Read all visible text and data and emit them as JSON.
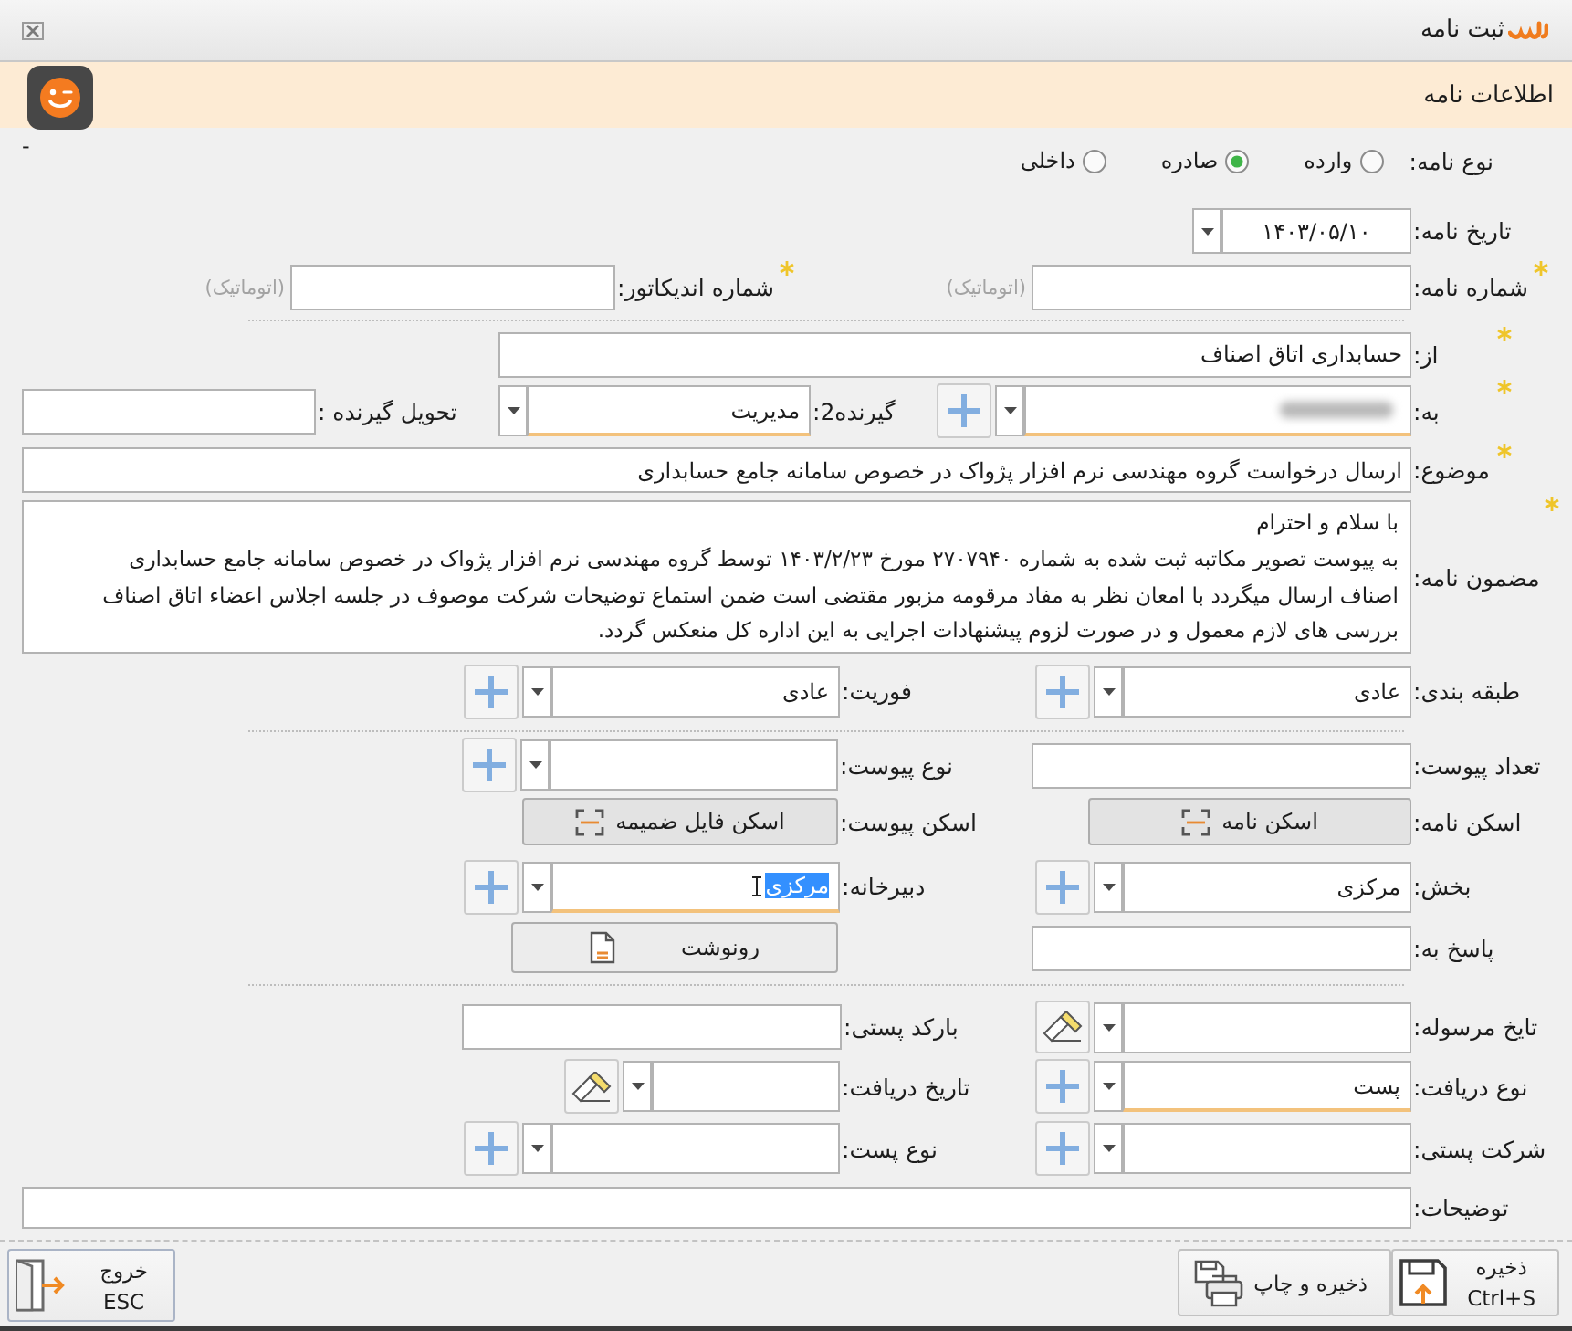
{
  "window": {
    "title": "ثبت نامه"
  },
  "header": {
    "title": "اطلاعات نامه",
    "mark": "-"
  },
  "letter_type": {
    "label": "نوع نامه:",
    "options": [
      {
        "label": "وارده",
        "selected": false
      },
      {
        "label": "صادره",
        "selected": true
      },
      {
        "label": "داخلی",
        "selected": false
      }
    ]
  },
  "sections": [
    {
      "rows": [
        {
          "fields": [
            {
              "kind": "date",
              "label": "تاریخ نامه:",
              "required": false,
              "value": "۱۴۰۳/۰۵/۱۰"
            }
          ]
        },
        {
          "fields": [
            {
              "kind": "text",
              "label": "شماره نامه:",
              "required": true,
              "note": "(اتوماتیک)"
            },
            {
              "kind": "text",
              "label": "شماره اندیکاتور:",
              "required": true,
              "note": "(اتوماتیک)"
            }
          ]
        }
      ]
    },
    {
      "rows": [
        {
          "fields": [
            {
              "kind": "text",
              "label": "از:",
              "required": true,
              "value": "حسابداری اتاق اصناف"
            }
          ]
        },
        {
          "fields": [
            {
              "kind": "combo",
              "label": "به:",
              "required": true,
              "redacted": true,
              "highlighted": true,
              "add_button": true,
              "clear_button": false
            },
            {
              "kind": "combo",
              "label": "گیرنده2:",
              "required": false,
              "value": "مدیریت",
              "highlighted": true,
              "add_button": false,
              "clear_button": false
            },
            {
              "kind": "text",
              "label": "تحویل گیرنده :",
              "required": false
            }
          ]
        },
        {
          "fields": [
            {
              "kind": "text",
              "label": "موضوع:",
              "required": true,
              "value": "ارسال درخواست گروه مهندسی نرم افزار پژواک در خصوص سامانه جامع حسابداری"
            }
          ]
        },
        {
          "fields": [
            {
              "kind": "textarea",
              "label": "مضمون نامه:",
              "required": true,
              "lines": [
                "با سلام و احترام",
                "به پیوست تصویر مکاتبه ثبت شده به شماره ۲۷۰۷۹۴۰ مورخ ۱۴۰۳/۲/۲۳ توسط گروه مهندسی نرم افزار پژواک در خصوص سامانه جامع حسابداری",
                "اصناف ارسال میگردد با امعان نظر به مفاد مرقومه مزبور مقتضی است ضمن استماع توضیحات شرکت موصوف در جلسه اجلاس اعضاء اتاق اصناف",
                "بررسی های لازم معمول و در صورت لزوم پیشنهادات اجرایی به این اداره کل منعکس گردد."
              ]
            }
          ]
        },
        {
          "fields": [
            {
              "kind": "combo",
              "label": "طبقه بندی:",
              "required": false,
              "value": "عادی",
              "highlighted": false,
              "add_button": true,
              "clear_button": false
            },
            {
              "kind": "combo",
              "label": "فوریت:",
              "required": false,
              "value": "عادی",
              "highlighted": false,
              "add_button": true,
              "clear_button": false
            }
          ]
        }
      ]
    },
    {
      "rows": [
        {
          "fields": [
            {
              "kind": "text",
              "label": "تعداد پیوست:",
              "required": false
            },
            {
              "kind": "combo",
              "label": "نوع پیوست:",
              "required": false,
              "highlighted": false,
              "add_button": true,
              "clear_button": false
            }
          ]
        },
        {
          "fields": [
            {
              "kind": "scan",
              "label": "اسکن نامه:",
              "required": false,
              "button": "اسکن نامه"
            },
            {
              "kind": "scan",
              "label": "اسکن پیوست:",
              "required": false,
              "button": "اسکن فایل ضمیمه"
            }
          ]
        },
        {
          "fields": [
            {
              "kind": "combo",
              "label": "بخش:",
              "required": false,
              "value": "مرکزی",
              "highlighted": false,
              "add_button": true,
              "clear_button": false
            },
            {
              "kind": "combo",
              "label": "دبیرخانه:",
              "required": false,
              "value": "مرکزی",
              "highlighted": true,
              "text_selected": true,
              "add_button": true,
              "clear_button": false
            }
          ]
        },
        {
          "fields": [
            {
              "kind": "text",
              "label": "پاسخ به:",
              "required": false
            },
            {
              "kind": "copy",
              "button": "رونوشت"
            }
          ]
        }
      ]
    },
    {
      "rows": [
        {
          "fields": [
            {
              "kind": "combo",
              "label": "تایخ مرسوله:",
              "required": false,
              "highlighted": false,
              "add_button": false,
              "clear_button": true
            },
            {
              "kind": "text",
              "label": "بارکد پستی:",
              "required": false
            }
          ]
        },
        {
          "fields": [
            {
              "kind": "combo",
              "label": "نوع دریافت:",
              "required": false,
              "value": "پست",
              "highlighted": true,
              "add_button": true,
              "clear_button": false
            },
            {
              "kind": "combo",
              "label": "تاریخ دریافت:",
              "required": false,
              "highlighted": false,
              "add_button": false,
              "clear_button": true
            }
          ]
        },
        {
          "fields": [
            {
              "kind": "combo",
              "label": "شرکت پستی:",
              "required": false,
              "highlighted": false,
              "add_button": true,
              "clear_button": false
            },
            {
              "kind": "combo",
              "label": "نوع پست:",
              "required": false,
              "highlighted": false,
              "add_button": true,
              "clear_button": false
            }
          ]
        },
        {
          "fields": [
            {
              "kind": "text",
              "label": "توضیحات:",
              "required": false
            }
          ]
        }
      ]
    }
  ],
  "footer": {
    "actions": [
      {
        "kind": "save",
        "label": "ذخیره",
        "shortcut": "Ctrl+S"
      },
      {
        "kind": "save_print",
        "label": "ذخیره و چاپ"
      },
      {
        "kind": "exit",
        "label": "خروج",
        "shortcut": "ESC"
      }
    ]
  }
}
